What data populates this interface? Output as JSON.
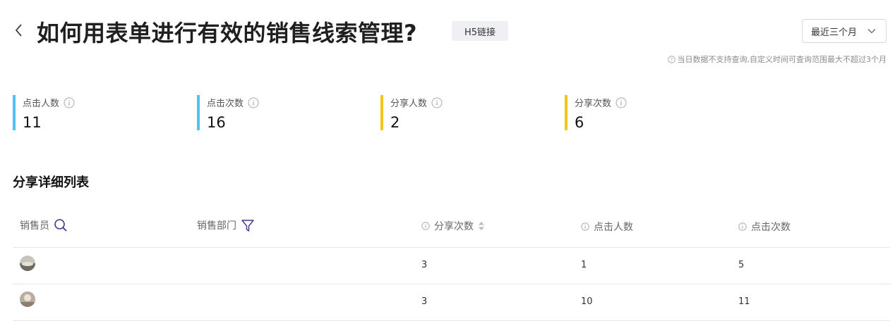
{
  "header": {
    "title": "如何用表单进行有效的销售线索管理?",
    "tag": "H5链接",
    "range_select": "最近三个月",
    "notice": "当日数据不支持查询,自定义时间可查询范围最大不超过3个月"
  },
  "stats": [
    {
      "label": "点击人数",
      "value": "11",
      "color": "#4fc3f7"
    },
    {
      "label": "点击次数",
      "value": "16",
      "color": "#4fc3f7"
    },
    {
      "label": "分享人数",
      "value": "2",
      "color": "#f5c518"
    },
    {
      "label": "分享次数",
      "value": "6",
      "color": "#f5c518"
    }
  ],
  "table": {
    "title": "分享详细列表",
    "columns": [
      "销售员",
      "销售部门",
      "分享次数",
      "点击人数",
      "点击次数"
    ],
    "rows": [
      {
        "salesperson": "",
        "department": "",
        "shares": "3",
        "click_users": "1",
        "clicks": "5"
      },
      {
        "salesperson": "",
        "department": "",
        "shares": "3",
        "click_users": "10",
        "clicks": "11"
      }
    ]
  }
}
